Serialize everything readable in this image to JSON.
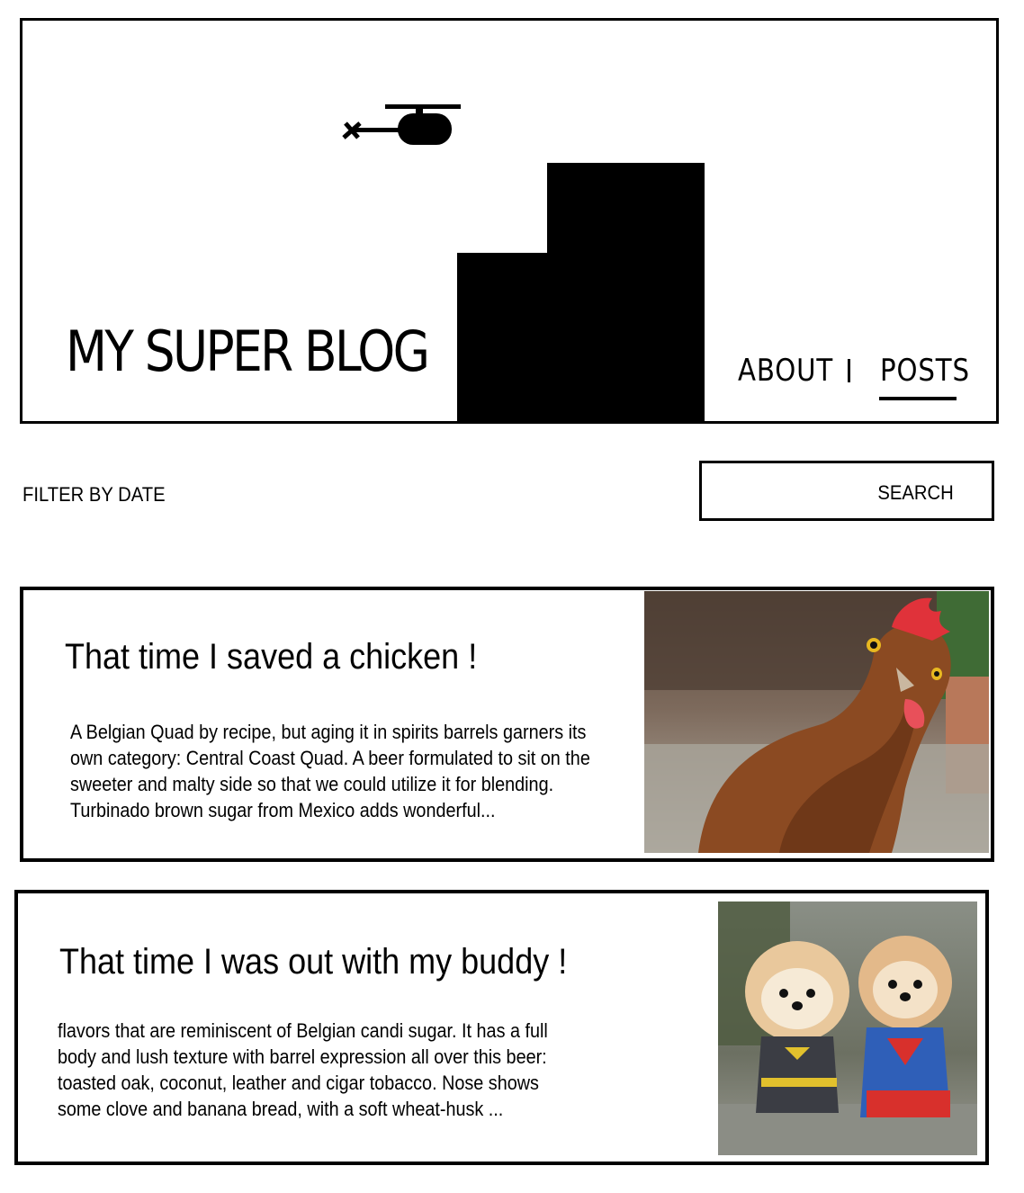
{
  "header": {
    "title": "MY SUPER BLOG",
    "nav": {
      "about": "ABOUT",
      "posts": "POSTS",
      "active": "posts"
    }
  },
  "toolbar": {
    "filter_label": "FILTER BY DATE",
    "search_button": "SEARCH",
    "search_value": ""
  },
  "posts": [
    {
      "title": "That time I saved a chicken !",
      "excerpt": "A Belgian Quad by recipe, but aging it in spirits barrels garners its own category: Central Coast Quad. A beer formulated to sit on the sweeter and malty side so that we could utilize it for blending. Turbinado brown sugar from Mexico adds wonderful...",
      "image": "chicken-photo"
    },
    {
      "title": "That time I was out with my buddy !",
      "excerpt": "flavors that are reminiscent of Belgian candi sugar. It has a full body and lush texture with barrel expression all over this beer: toasted oak, coconut, leather and cigar tobacco. Nose shows some clove and banana bread, with a soft wheat-husk ...",
      "image": "pomeranian-dogs-photo"
    }
  ],
  "colors": {
    "ink": "#000000",
    "background": "#ffffff"
  }
}
